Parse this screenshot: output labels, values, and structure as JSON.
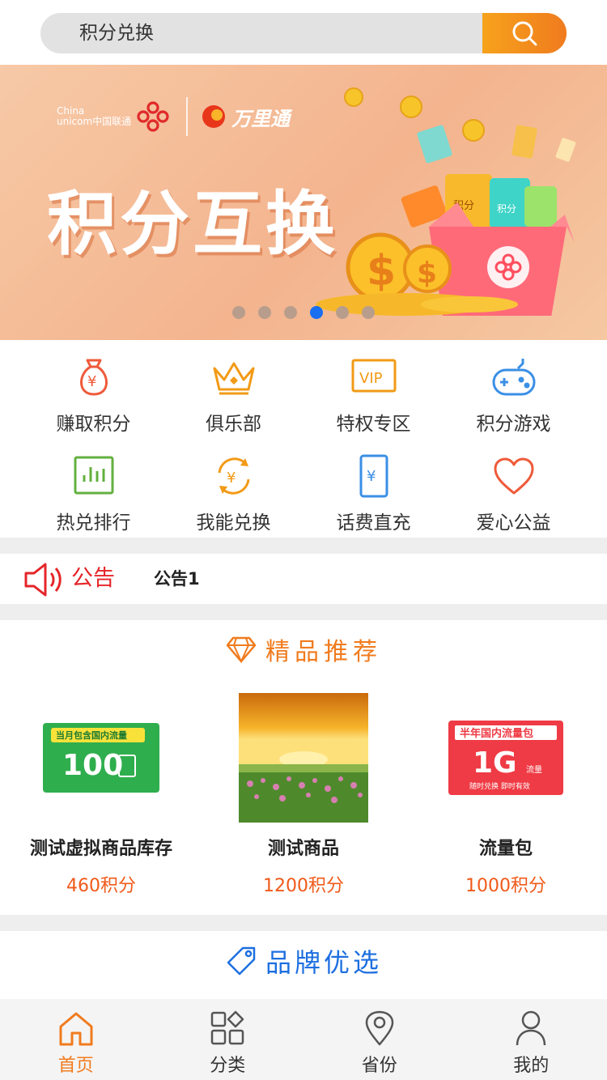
{
  "search": {
    "text": "积分兑换"
  },
  "banner": {
    "brand_cu_en_1": "China",
    "brand_cu_en_2": "unicom中国联通",
    "brand_wlt": "万里通",
    "title": "积分互换",
    "coin_label": "积分",
    "dots_total": 6,
    "dots_active_index": 3
  },
  "grid": {
    "items": [
      {
        "label": "赚取积分",
        "icon": "money-bag-icon"
      },
      {
        "label": "俱乐部",
        "icon": "crown-icon"
      },
      {
        "label": "特权专区",
        "icon": "vip-icon"
      },
      {
        "label": "积分游戏",
        "icon": "gamepad-icon"
      },
      {
        "label": "热兑排行",
        "icon": "chart-icon"
      },
      {
        "label": "我能兑换",
        "icon": "exchange-icon"
      },
      {
        "label": "话费直充",
        "icon": "phone-recharge-icon"
      },
      {
        "label": "爱心公益",
        "icon": "heart-icon"
      }
    ]
  },
  "notice": {
    "label": "公告",
    "text": "公告1"
  },
  "featured": {
    "title": "精品推荐",
    "products": [
      {
        "name": "测试虚拟商品库存",
        "points": "460积分",
        "image_text_top": "当月包含国内流量",
        "image_text_main": "100"
      },
      {
        "name": "测试商品",
        "points": "1200积分"
      },
      {
        "name": "流量包",
        "points": "1000积分",
        "image_text_top": "半年国内流量包",
        "image_text_main": "1G",
        "image_text_side": "流量",
        "image_text_bottom": "随时兑换   即时有效"
      }
    ]
  },
  "brands": {
    "title": "品牌优选"
  },
  "tabbar": {
    "tabs": [
      {
        "label": "首页",
        "icon": "home-icon",
        "active": true
      },
      {
        "label": "分类",
        "icon": "category-icon",
        "active": false
      },
      {
        "label": "省份",
        "icon": "location-icon",
        "active": false
      },
      {
        "label": "我的",
        "icon": "user-icon",
        "active": false
      }
    ]
  },
  "colors": {
    "accent": "#f07b1e",
    "notice_red": "#e5252a",
    "brand_blue": "#1d6fe0",
    "dot_active": "#1a6ef0"
  }
}
